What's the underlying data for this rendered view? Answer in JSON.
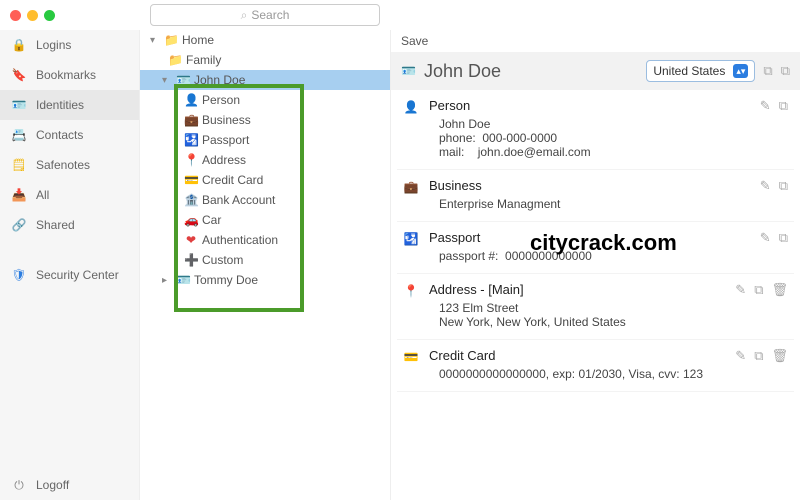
{
  "search": {
    "placeholder": "Search"
  },
  "sidebar": {
    "items": [
      {
        "label": "Logins",
        "icon": "🔒",
        "color": "#4caf50"
      },
      {
        "label": "Bookmarks",
        "icon": "🔖",
        "color": "#2b7de0"
      },
      {
        "label": "Identities",
        "icon": "🪪",
        "color": "#2b7de0"
      },
      {
        "label": "Contacts",
        "icon": "📇",
        "color": "#f0b400"
      },
      {
        "label": "Safenotes",
        "icon": "🗒",
        "color": "#f0b400"
      },
      {
        "label": "All",
        "icon": "📥",
        "color": "#888"
      },
      {
        "label": "Shared",
        "icon": "🔗",
        "color": "#3bb3e0"
      },
      {
        "label": "Security Center",
        "icon": "🛡",
        "color": "#2b7de0"
      }
    ],
    "logoff": "Logoff"
  },
  "tree": {
    "root": "Home",
    "folder": "Family",
    "identity_selected": "John Doe",
    "subitems": [
      {
        "label": "Person",
        "icon": "👤"
      },
      {
        "label": "Business",
        "icon": "💼"
      },
      {
        "label": "Passport",
        "icon": "🛂"
      },
      {
        "label": "Address",
        "icon": "📍"
      },
      {
        "label": "Credit Card",
        "icon": "💳"
      },
      {
        "label": "Bank Account",
        "icon": "🏦"
      },
      {
        "label": "Car",
        "icon": "🚗"
      },
      {
        "label": "Authentication",
        "icon": "❤"
      },
      {
        "label": "Custom",
        "icon": "➕"
      }
    ],
    "identity_other": "Tommy Doe"
  },
  "detail": {
    "save": "Save",
    "name": "John Doe",
    "country": "United States",
    "sections": {
      "person": {
        "title": "Person",
        "name": "John Doe",
        "phone_label": "phone:",
        "phone": "000-000-0000",
        "mail_label": "mail:",
        "mail": "john.doe@email.com"
      },
      "business": {
        "title": "Business",
        "company": "Enterprise Managment"
      },
      "passport": {
        "title": "Passport",
        "label": "passport #:",
        "number": "0000000000000"
      },
      "address": {
        "title": "Address - [Main]",
        "line1": "123 Elm Street",
        "line2": "New York, New York, United States"
      },
      "creditcard": {
        "title": "Credit Card",
        "line": "0000000000000000,   exp:   01/2030, Visa,   cvv:   123"
      }
    }
  },
  "watermark": "citycrack.com"
}
